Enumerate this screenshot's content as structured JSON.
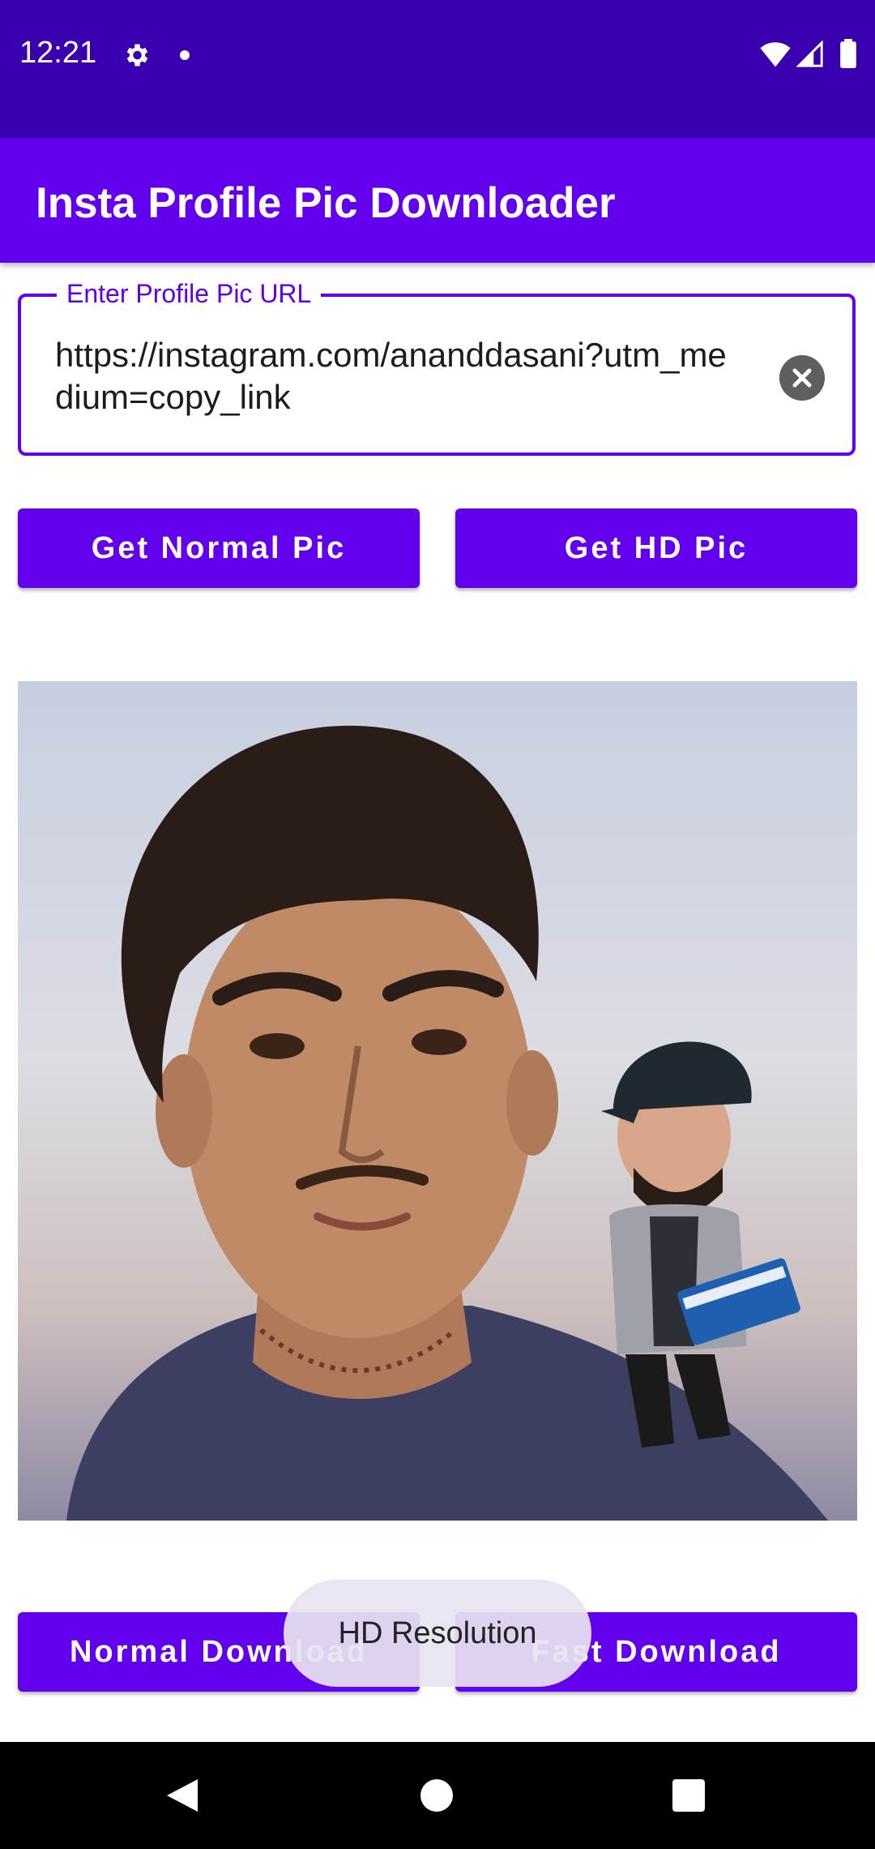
{
  "status_bar": {
    "time": "12:21"
  },
  "app_bar": {
    "title": "Insta Profile Pic Downloader"
  },
  "url_field": {
    "label": "Enter Profile Pic URL",
    "value": "https://instagram.com/ananddasani?utm_medium=copy_link"
  },
  "buttons": {
    "normal_pic": "Get Normal Pic",
    "hd_pic": "Get HD Pic",
    "normal_download": "Normal Download",
    "fast_download": "Fast Download"
  },
  "toast": {
    "text": "HD Resolution"
  },
  "colors": {
    "primary": "#6200ee",
    "status_bar": "#3a00b0"
  }
}
